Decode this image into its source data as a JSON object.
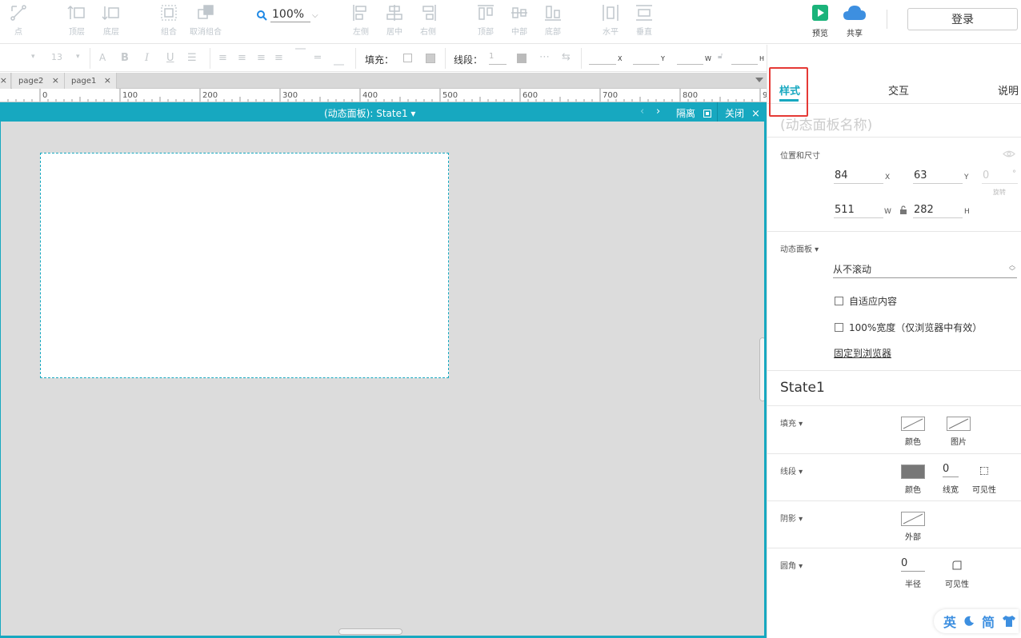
{
  "toolbar": {
    "tools": [
      {
        "id": "point",
        "label": "点"
      },
      {
        "id": "top-layer",
        "label": "顶层"
      },
      {
        "id": "bottom-layer",
        "label": "底层"
      },
      {
        "id": "group",
        "label": "组合"
      },
      {
        "id": "ungroup",
        "label": "取消组合"
      },
      {
        "id": "align-left",
        "label": "左侧"
      },
      {
        "id": "align-center",
        "label": "居中"
      },
      {
        "id": "align-right",
        "label": "右侧"
      },
      {
        "id": "align-top",
        "label": "顶部"
      },
      {
        "id": "align-middle",
        "label": "中部"
      },
      {
        "id": "align-bottom",
        "label": "底部"
      },
      {
        "id": "distribute-h",
        "label": "水平"
      },
      {
        "id": "distribute-v",
        "label": "垂直"
      }
    ],
    "zoom": "100%",
    "preview": "预览",
    "share": "共享",
    "login": "登录"
  },
  "format": {
    "font_size": "13",
    "fill_label": "填充：",
    "line_label": "线段：",
    "line_width": "1",
    "x_axis": "X",
    "y_axis": "Y",
    "w_axis": "W",
    "h_axis": "H"
  },
  "page_tabs": [
    {
      "label": "page2"
    },
    {
      "label": "page1"
    }
  ],
  "ruler": {
    "ticks": [
      "0",
      "100",
      "200",
      "300",
      "400",
      "500",
      "600",
      "700",
      "800",
      "9"
    ]
  },
  "dynamic_panel": {
    "title": "(动态面板): State1 ▾",
    "prev": "‹",
    "next": "›",
    "isolate": "隔离",
    "close": "关闭"
  },
  "inspector": {
    "tabs": {
      "style": "样式",
      "interaction": "交互",
      "notes": "说明"
    },
    "name_placeholder": "(动态面板名称)",
    "position_title": "位置和尺寸",
    "x": "84",
    "x_axis": "X",
    "y": "63",
    "y_axis": "Y",
    "rotation": "0",
    "rotation_unit": "°",
    "rotation_label": "旋转",
    "w": "511",
    "w_axis": "W",
    "h": "282",
    "h_axis": "H",
    "dp_title": "动态面板 ▾",
    "scroll_option": "从不滚动",
    "fit_content": "自适应内容",
    "full_width": "100%宽度（仅浏览器中有效）",
    "pin_browser": "固定到浏览器",
    "state_title": "State1",
    "fill_title": "填充 ▾",
    "fill_color": "颜色",
    "fill_image": "图片",
    "line_title": "线段 ▾",
    "line_color": "颜色",
    "line_width_value": "0",
    "line_width_label": "线宽",
    "line_visibility": "可见性",
    "shadow_title": "阴影 ▾",
    "shadow_outer": "外部",
    "corner_title": "圆角 ▾",
    "corner_radius_value": "0",
    "corner_radius_label": "半径",
    "corner_visibility": "可见性"
  },
  "ime": {
    "lang": "英",
    "mode": "简"
  },
  "colors": {
    "accent": "#17a8c0",
    "highlight": "#e53935",
    "preview_green": "#1ab37a",
    "share_blue": "#3d8fe0"
  }
}
